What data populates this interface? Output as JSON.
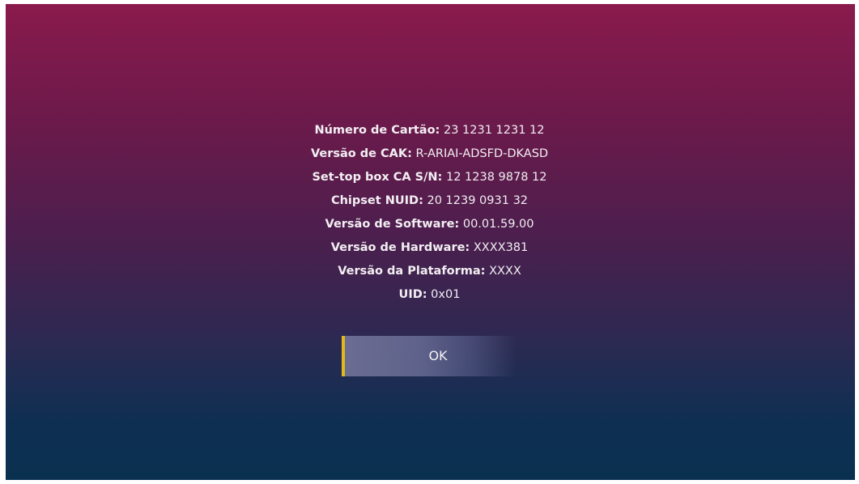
{
  "info": {
    "rows": [
      {
        "label": "Número de Cartão:",
        "value": "23 1231 1231 12"
      },
      {
        "label": "Versão de CAK:",
        "value": "R-ARIAI-ADSFD-DKASD"
      },
      {
        "label": "Set-top box CA S/N:",
        "value": "12 1238 9878 12"
      },
      {
        "label": "Chipset NUID:",
        "value": "20 1239 0931 32"
      },
      {
        "label": "Versão de Software:",
        "value": "00.01.59.00"
      },
      {
        "label": "Versão de Hardware:",
        "value": "XXXX381"
      },
      {
        "label": "Versão da Plataforma:",
        "value": "XXXX"
      },
      {
        "label": "UID:",
        "value": "0x01"
      }
    ]
  },
  "ok_button": {
    "label": "OK"
  },
  "colors": {
    "accent": "#e2b81d",
    "text": "#f2eef2",
    "gradient_top": "#8a1a4c",
    "gradient_bottom": "#0a3050"
  }
}
